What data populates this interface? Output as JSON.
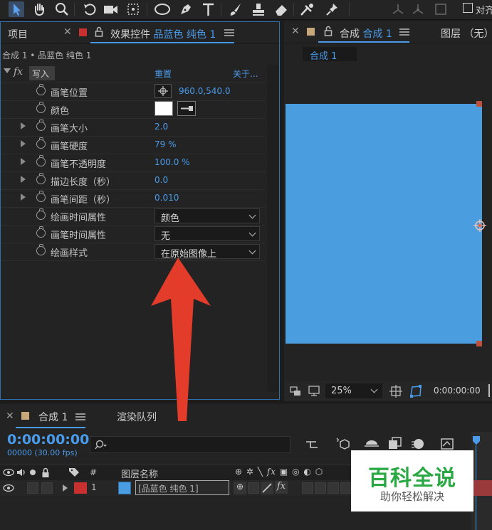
{
  "colors": {
    "accent_blue": "#4a9bea",
    "solid_color": "#4a9ee0",
    "label_red": "#c8312f",
    "label_tan": "#c8a87a",
    "arrow_red": "#e33c2a",
    "watermark_green": "#2aa844"
  },
  "toolbar": {
    "tools": [
      "selection-tool-icon",
      "hand-tool-icon",
      "zoom-tool-icon",
      "rotate-tool-icon",
      "camera-tool-icon",
      "pan-behind-tool-icon",
      "ellipse-tool-icon",
      "pen-tool-icon",
      "text-tool-icon",
      "brush-tool-icon",
      "clone-stamp-tool-icon",
      "eraser-tool-icon",
      "roto-brush-tool-icon",
      "puppet-pin-tool-icon"
    ],
    "snap_label": "对齐"
  },
  "effect_panel": {
    "project_tab": "项目",
    "tab_prefix": "效果控件",
    "tab_layer": "品蓝色 纯色 1",
    "breadcrumb": "合成 1 • 品蓝色 纯色 1",
    "effect_name": "写入",
    "reset_label": "重置",
    "about_label": "关于...",
    "properties": [
      {
        "label": "画笔位置",
        "value": "960.0,540.0"
      },
      {
        "label": "颜色",
        "value": ""
      },
      {
        "label": "画笔大小",
        "value": "2.0"
      },
      {
        "label": "画笔硬度",
        "value": "79 %"
      },
      {
        "label": "画笔不透明度",
        "value": "100.0 %"
      },
      {
        "label": "描边长度（秒）",
        "value": "0.0"
      },
      {
        "label": "画笔间距（秒）",
        "value": "0.010"
      },
      {
        "label": "绘画时间属性",
        "value": "颜色"
      },
      {
        "label": "画笔时间属性",
        "value": "无"
      },
      {
        "label": "绘画样式",
        "value": "在原始图像上"
      }
    ]
  },
  "comp_panel": {
    "tab_prefix": "合成",
    "tab_name": "合成 1",
    "layer_tab": "图层 （无）",
    "subtab": "合成 1",
    "zoom": "25%",
    "timecode": "0:00:00:00"
  },
  "timeline": {
    "tab_name": "合成 1",
    "render_queue_tab": "渲染队列",
    "current_time": "0:00:00:00",
    "frame_info": "00000 (30.00 fps)",
    "search_placeholder": "",
    "col_name": "图层名称",
    "col_number": "#",
    "layer": {
      "index": "1",
      "name": "[品蓝色 纯色 1]"
    }
  },
  "watermark": {
    "title": "百科全说",
    "subtitle": "助你轻松解决"
  }
}
